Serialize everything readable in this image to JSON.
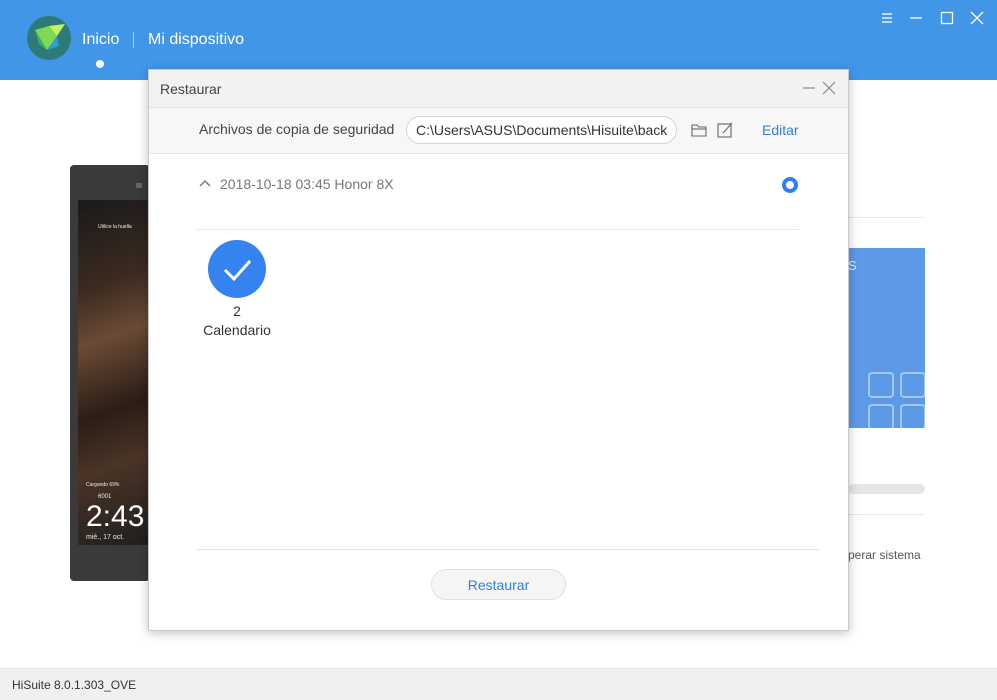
{
  "app": {
    "nav": {
      "home": "Inicio",
      "device": "Mi dispositivo"
    },
    "window_controls": [
      "menu-icon",
      "minimize-icon",
      "maximize-icon",
      "close-icon"
    ],
    "accent_color": "#4296e8",
    "version": "HiSuite 8.0.1.303_OVE"
  },
  "phone": {
    "hint": "Utilice la huella",
    "charging": "Cargando 69%",
    "steps": "6001",
    "time": "2:43",
    "date": "mié., 17 oct."
  },
  "background": {
    "card_letter": "S",
    "recover_text": "perar sistema"
  },
  "dialog": {
    "title": "Restaurar",
    "path_label": "Archivos de copia de seguridad",
    "path_value": "C:\\Users\\ASUS\\Documents\\Hisuite\\backup",
    "edit_label": "Editar",
    "backup": {
      "label": "2018-10-18 03:45 Honor 8X",
      "selected": true
    },
    "items": [
      {
        "count": "2",
        "name": "Calendario",
        "checked": true
      }
    ],
    "restore_button": "Restaurar"
  }
}
